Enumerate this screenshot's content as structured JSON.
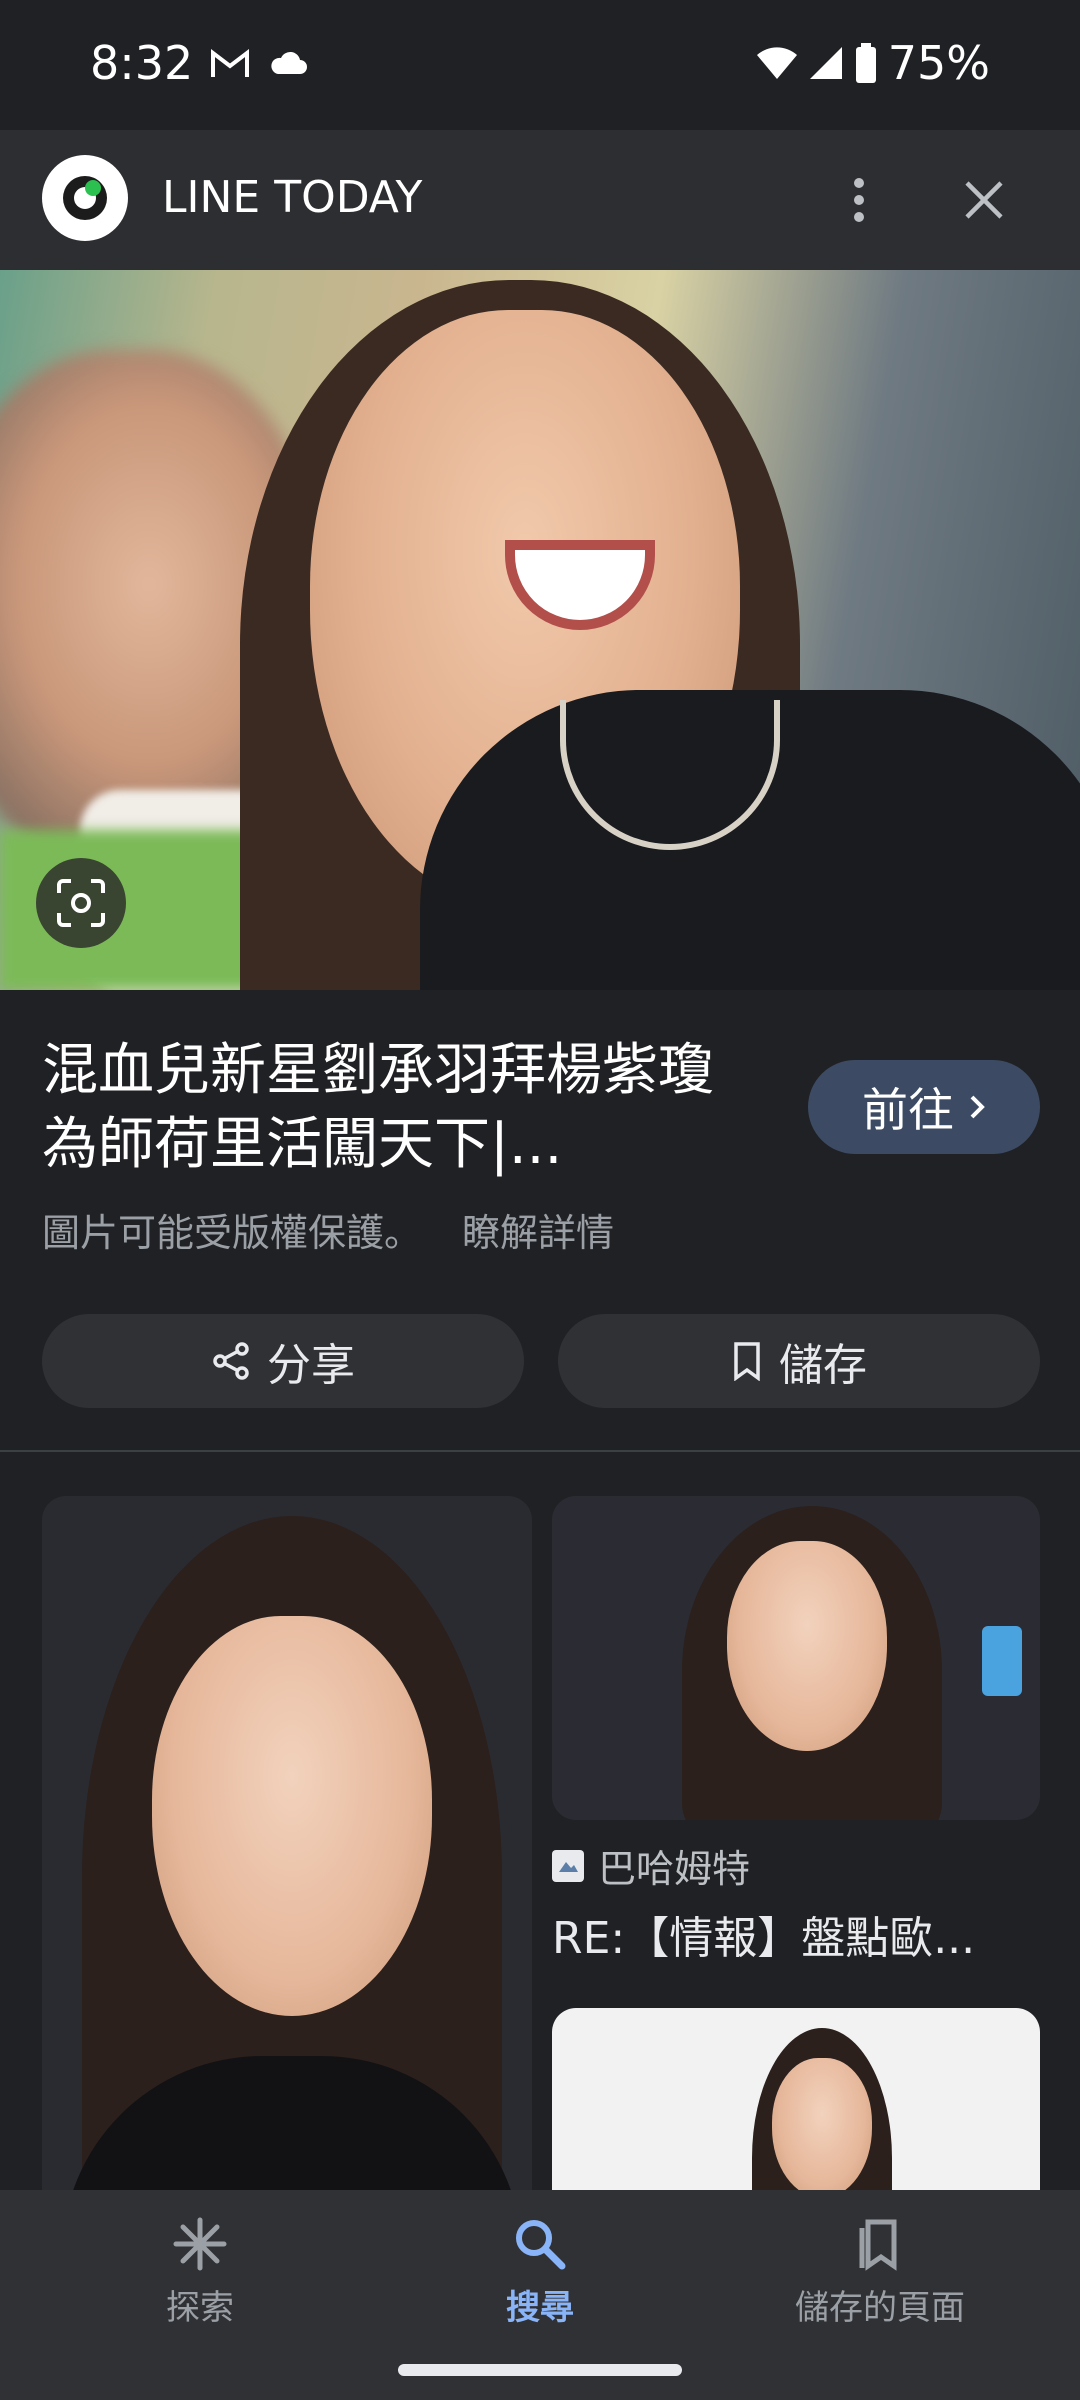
{
  "status_bar": {
    "time": "8:32",
    "battery": "75%"
  },
  "header": {
    "site_name": "LINE TODAY"
  },
  "result": {
    "title": "混血兒新星劉承羽拜楊紫瓊為師荷里活闖天下|...",
    "visit_label": "前往",
    "copyright_note": "圖片可能受版權保護。",
    "learn_more": "瞭解詳情",
    "share_label": "分享",
    "save_label": "儲存"
  },
  "related": {
    "source_name": "巴哈姆特",
    "title": "RE:【情報】盤點歐..."
  },
  "bottom_nav": {
    "items": [
      {
        "label": "探索",
        "icon": "asterisk-icon",
        "active": false
      },
      {
        "label": "搜尋",
        "icon": "search-icon",
        "active": true
      },
      {
        "label": "儲存的頁面",
        "icon": "bookmarks-icon",
        "active": false
      }
    ]
  },
  "colors": {
    "background": "#202124",
    "header": "#2d2e31",
    "accent": "#8ab4f8",
    "visit_button": "#3c4b63"
  }
}
